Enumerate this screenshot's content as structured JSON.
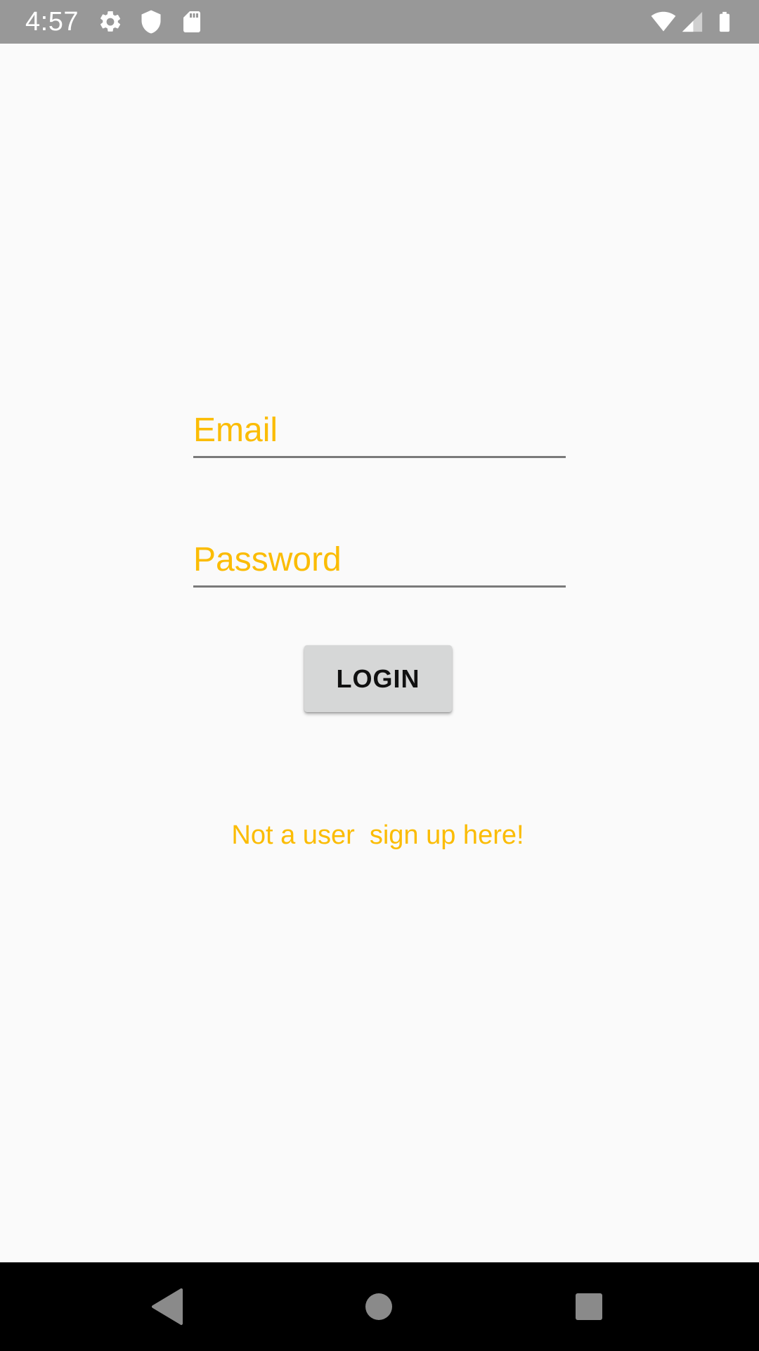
{
  "status_bar": {
    "time": "4:57",
    "icons": [
      "settings-icon",
      "shield-icon",
      "sd-card-icon",
      "wifi-icon",
      "signal-icon",
      "battery-icon"
    ]
  },
  "form": {
    "email_placeholder": "Email",
    "password_placeholder": "Password",
    "login_label": "LOGIN",
    "signup_text": "Not a user  sign up here!"
  },
  "navigation": {
    "icons": [
      "back-icon",
      "home-icon",
      "recents-icon"
    ]
  },
  "colors": {
    "accent": "#fbbc04",
    "status_bar": "#989898",
    "background": "#fafafa",
    "button": "#d6d7d7",
    "nav_bar": "#000000",
    "nav_icons": "#8a8a8a"
  }
}
